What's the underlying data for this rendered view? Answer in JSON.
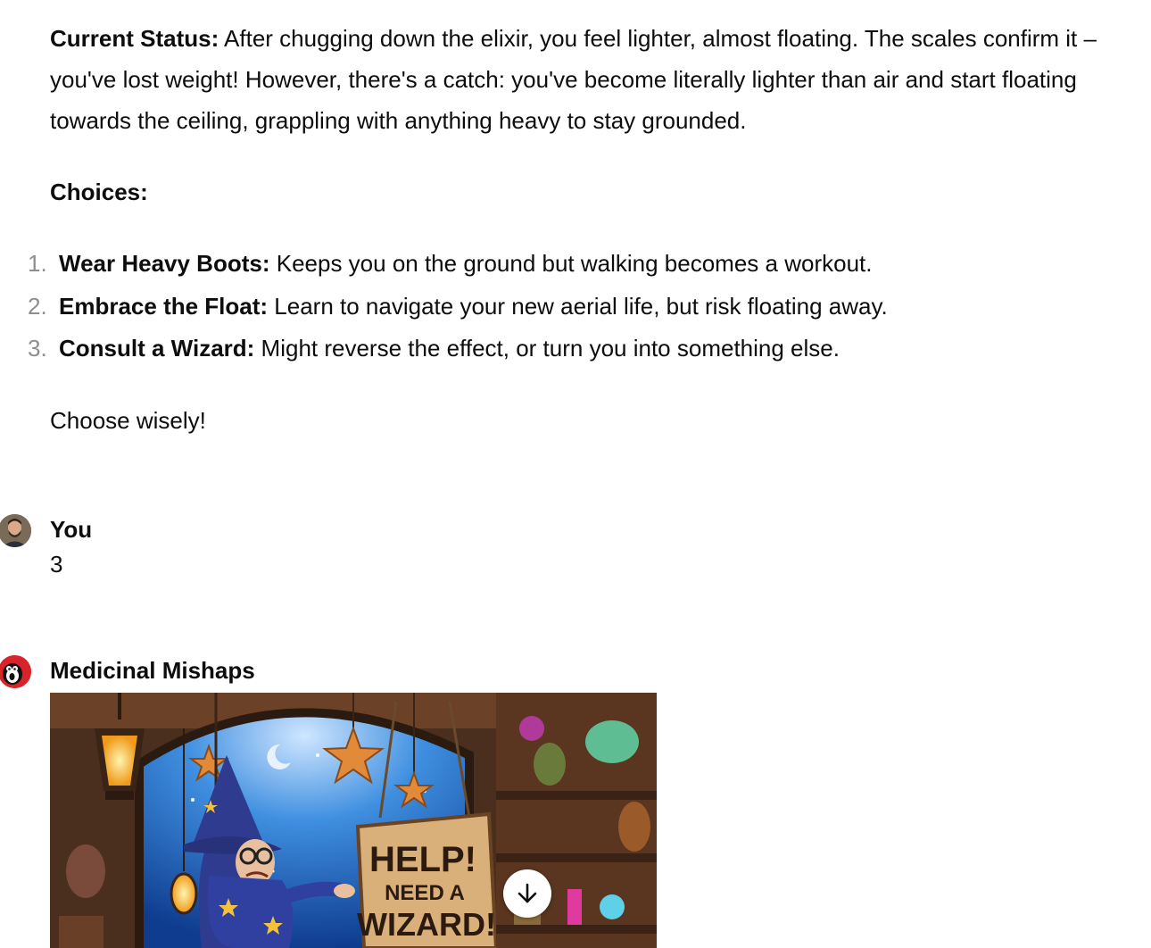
{
  "conversation": {
    "assistant_message": {
      "status_label": "Current Status:",
      "status_text": " After chugging down the elixir, you feel lighter, almost floating. The scales confirm it – you've lost weight! However, there's a catch: you've become literally lighter than air and start floating towards the ceiling, grappling with anything heavy to stay grounded.",
      "choices_heading": "Choices:",
      "choices": [
        {
          "num": "1.",
          "title": "Wear Heavy Boots:",
          "text": " Keeps you on the ground but walking becomes a workout."
        },
        {
          "num": "2.",
          "title": "Embrace the Float:",
          "text": " Learn to navigate your new aerial life, but risk floating away."
        },
        {
          "num": "3.",
          "title": "Consult a Wizard:",
          "text": " Might reverse the effect, or turn you into something else."
        }
      ],
      "closing": "Choose wisely!"
    },
    "user_turn": {
      "sender": "You",
      "message": "3"
    },
    "assistant_turn": {
      "sender": "Medicinal Mishaps",
      "image_sign_lines": [
        "HELP!",
        "NEED A",
        "WIZARD!"
      ]
    }
  },
  "icons": {
    "scroll_down": "arrow-down-icon",
    "user_avatar": "user-avatar",
    "gpt_avatar": "gpt-logo-avatar"
  },
  "colors": {
    "text": "#0d0d0d",
    "list_number": "#8e8e8e",
    "gpt_avatar_bg": "#d9232a"
  }
}
